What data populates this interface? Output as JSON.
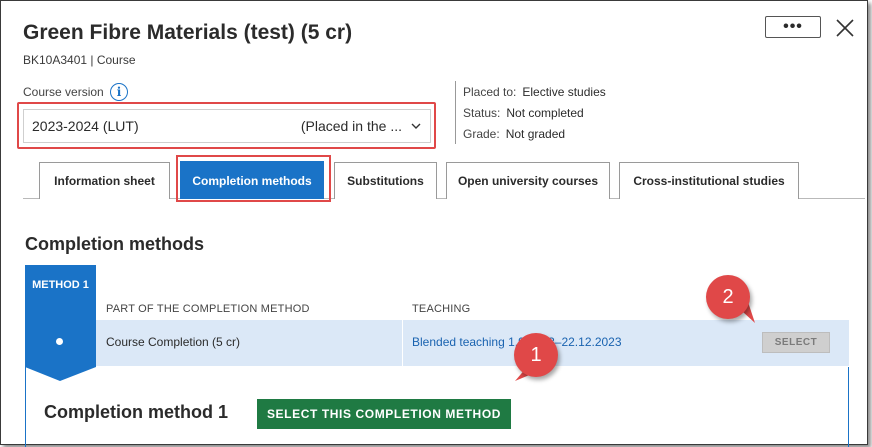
{
  "course": {
    "title": "Green Fibre Materials (test) (5 cr)",
    "code_line": "BK10A3401 | Course"
  },
  "header": {
    "more_label": "•••",
    "close_icon": "close-icon"
  },
  "version": {
    "label": "Course version",
    "info_icon_text": "i",
    "selected_value": "2023-2024 (LUT)",
    "selected_extra": "(Placed in the ..."
  },
  "meta": [
    {
      "key": "Placed to:",
      "value": "Elective studies"
    },
    {
      "key": "Status:",
      "value": "Not completed"
    },
    {
      "key": "Grade:",
      "value": "Not graded"
    }
  ],
  "tabs": [
    {
      "label": "Information sheet",
      "active": false
    },
    {
      "label": "Completion methods",
      "active": true
    },
    {
      "label": "Substitutions",
      "active": false
    },
    {
      "label": "Open university courses",
      "active": false
    },
    {
      "label": "Cross-institutional studies",
      "active": false
    }
  ],
  "section": {
    "title": "Completion methods"
  },
  "method": {
    "badge": "METHOD 1",
    "col_part": "PART OF THE COMPLETION METHOD",
    "col_teaching": "TEACHING",
    "row_part": "Course Completion (5 cr)",
    "row_teaching": "Blended teaching 1.9.2023–22.12.2023",
    "select_label": "SELECT",
    "detail_title": "Completion method 1",
    "select_method_label": "SELECT THIS COMPLETION METHOD"
  },
  "callouts": {
    "one": "1",
    "two": "2"
  },
  "colors": {
    "accent": "#1a73c7",
    "highlight": "#e04848",
    "primary_button": "#1f7a43"
  }
}
